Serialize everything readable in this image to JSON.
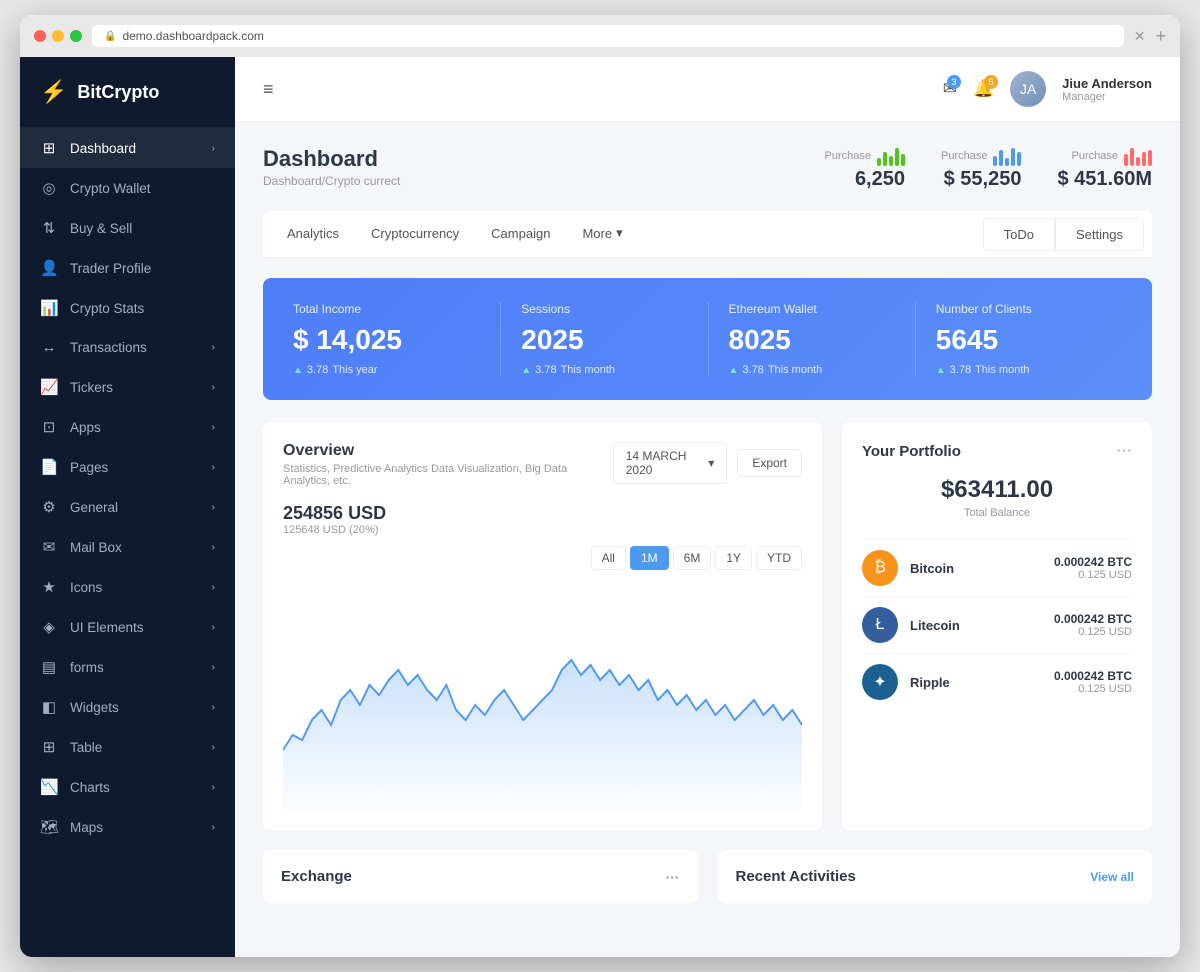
{
  "browser": {
    "url": "demo.dashboardpack.com",
    "close_label": "✕",
    "new_tab_label": "+"
  },
  "sidebar": {
    "logo_text": "BitCrypto",
    "logo_icon": "⚡",
    "items": [
      {
        "id": "dashboard",
        "label": "Dashboard",
        "icon": "⊞",
        "has_arrow": true,
        "active": true
      },
      {
        "id": "crypto-wallet",
        "label": "Crypto Wallet",
        "icon": "◎",
        "has_arrow": false,
        "active": false
      },
      {
        "id": "buy-sell",
        "label": "Buy & Sell",
        "icon": "⇅",
        "has_arrow": false,
        "active": false
      },
      {
        "id": "trader-profile",
        "label": "Trader Profile",
        "icon": "👤",
        "has_arrow": false,
        "active": false
      },
      {
        "id": "crypto-stats",
        "label": "Crypto Stats",
        "icon": "📊",
        "has_arrow": false,
        "active": false
      },
      {
        "id": "transactions",
        "label": "Transactions",
        "icon": "↔",
        "has_arrow": true,
        "active": false
      },
      {
        "id": "tickers",
        "label": "Tickers",
        "icon": "📈",
        "has_arrow": true,
        "active": false
      },
      {
        "id": "apps",
        "label": "Apps",
        "icon": "⊡",
        "has_arrow": true,
        "active": false
      },
      {
        "id": "pages",
        "label": "Pages",
        "icon": "📄",
        "has_arrow": true,
        "active": false
      },
      {
        "id": "general",
        "label": "General",
        "icon": "⚙",
        "has_arrow": true,
        "active": false
      },
      {
        "id": "mail-box",
        "label": "Mail Box",
        "icon": "✉",
        "has_arrow": true,
        "active": false
      },
      {
        "id": "icons",
        "label": "Icons",
        "icon": "★",
        "has_arrow": true,
        "active": false
      },
      {
        "id": "ui-elements",
        "label": "UI Elements",
        "icon": "◈",
        "has_arrow": true,
        "active": false
      },
      {
        "id": "forms",
        "label": "forms",
        "icon": "▤",
        "has_arrow": true,
        "active": false
      },
      {
        "id": "widgets",
        "label": "Widgets",
        "icon": "◧",
        "has_arrow": true,
        "active": false
      },
      {
        "id": "table",
        "label": "Table",
        "icon": "⊞",
        "has_arrow": true,
        "active": false
      },
      {
        "id": "charts",
        "label": "Charts",
        "icon": "📉",
        "has_arrow": true,
        "active": false
      },
      {
        "id": "maps",
        "label": "Maps",
        "icon": "🗺",
        "has_arrow": true,
        "active": false
      }
    ]
  },
  "topbar": {
    "menu_icon": "≡",
    "mail_badge": "3",
    "bell_badge": "5",
    "user_name": "Jiue Anderson",
    "user_role": "Manager"
  },
  "dashboard": {
    "title": "Dashboard",
    "subtitle": "Dashboard/Crypto currect",
    "purchase_stats": [
      {
        "label": "Purchase",
        "value": "6,250",
        "color": "#52c41a"
      },
      {
        "label": "Purchase",
        "value": "$ 55,250",
        "color": "#4e9af1"
      },
      {
        "label": "Purchase",
        "value": "$ 451.60M",
        "color": "#ff6b6b"
      }
    ]
  },
  "tabs": {
    "items": [
      {
        "label": "Analytics",
        "active": false
      },
      {
        "label": "Cryptocurrency",
        "active": false
      },
      {
        "label": "Campaign",
        "active": false
      },
      {
        "label": "More",
        "active": false,
        "has_arrow": true
      }
    ],
    "action_buttons": [
      {
        "label": "ToDo",
        "active": false
      },
      {
        "label": "Settings",
        "active": false
      }
    ]
  },
  "stats": [
    {
      "label": "Total Income",
      "value": "$ 14,025",
      "footer_num": "3.78",
      "footer_text": "This year"
    },
    {
      "label": "Sessions",
      "value": "2025",
      "footer_num": "3.78",
      "footer_text": "This month"
    },
    {
      "label": "Ethereum Wallet",
      "value": "8025",
      "footer_num": "3.78",
      "footer_text": "This month"
    },
    {
      "label": "Number of Clients",
      "value": "5645",
      "footer_num": "3.78",
      "footer_text": "This month"
    }
  ],
  "overview": {
    "title": "Overview",
    "subtitle": "Statistics, Predictive Analytics Data Visualization, Big Data Analytics, etc.",
    "date_label": "14 MARCH 2020",
    "export_label": "Export",
    "chart_amount": "254856 USD",
    "chart_sub": "125648 USD (20%)",
    "filter_buttons": [
      {
        "label": "All",
        "active": false
      },
      {
        "label": "1M",
        "active": true
      },
      {
        "label": "6M",
        "active": false
      },
      {
        "label": "1Y",
        "active": false
      },
      {
        "label": "YTD",
        "active": false
      }
    ]
  },
  "portfolio": {
    "title": "Your Portfolio",
    "balance": "$63411.00",
    "balance_label": "Total Balance",
    "items": [
      {
        "name": "Bitcoin",
        "btc": "0.000242 BTC",
        "usd": "0.125 USD",
        "color": "#f7931a",
        "symbol": "₿"
      },
      {
        "name": "Litecoin",
        "btc": "0.000242 BTC",
        "usd": "0.125 USD",
        "color": "#345d9d",
        "symbol": "Ł"
      },
      {
        "name": "Ripple",
        "btc": "0.000242 BTC",
        "usd": "0.125 USD",
        "color": "#1a6090",
        "symbol": "✦"
      }
    ]
  },
  "bottom": {
    "exchange_title": "Exchange",
    "activities_title": "Recent Activities",
    "view_all_label": "View all"
  }
}
